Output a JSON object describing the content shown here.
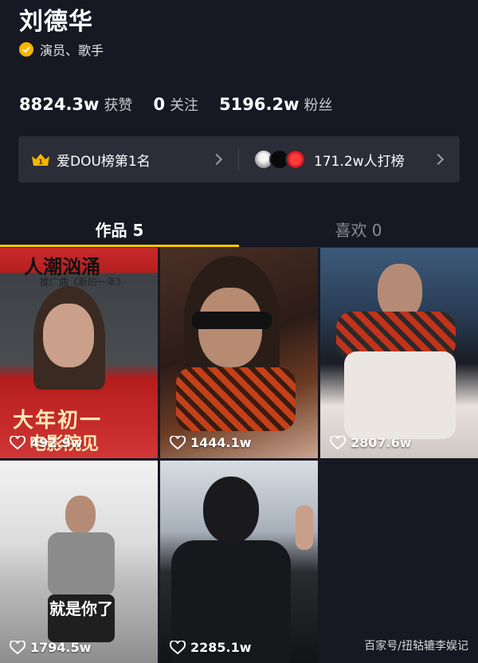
{
  "profile": {
    "name": "刘德华",
    "verification": "演员、歌手"
  },
  "stats": [
    {
      "value": "8824.3w",
      "label": "获赞"
    },
    {
      "value": "0",
      "label": "关注"
    },
    {
      "value": "5196.2w",
      "label": "粉丝"
    }
  ],
  "rank": {
    "badge_number": "1",
    "label": "爱DOU榜第1名",
    "boost_label": "171.2w人打榜"
  },
  "tabs": [
    {
      "label": "作品 5",
      "active": true
    },
    {
      "label": "喜欢 0",
      "active": false
    }
  ],
  "videos": [
    {
      "likes": "492.9w",
      "overlay_top": "人潮汹涌",
      "overlay_sub": "推广曲《新的一年》",
      "overlay_banner": "大年初一",
      "overlay_banner2": "电影院见"
    },
    {
      "likes": "1444.1w"
    },
    {
      "likes": "2807.6w"
    },
    {
      "likes": "1794.5w",
      "overlay_caption": "就是你了"
    },
    {
      "likes": "2285.1w"
    }
  ],
  "watermark": "百家号/扭轱辘李娱记",
  "colors": {
    "background": "#161823",
    "accent": "#f7c500",
    "verified": "#f7b500"
  }
}
